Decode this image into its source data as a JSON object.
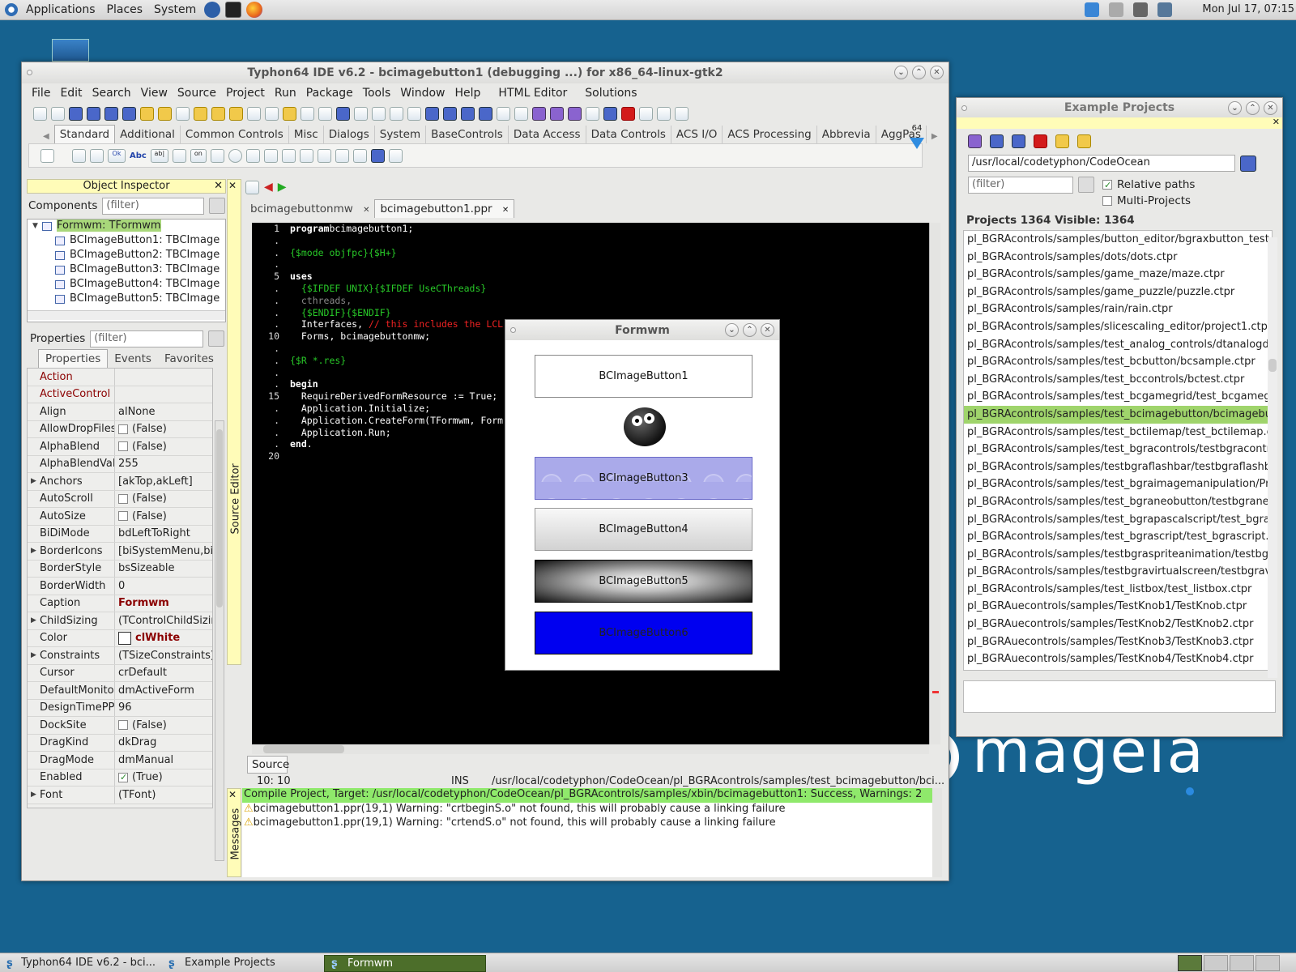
{
  "top_panel": {
    "menus": [
      "Applications",
      "Places",
      "System"
    ],
    "clock": "Mon Jul 17, 07:15"
  },
  "taskbar": {
    "items": [
      "Typhon64 IDE v6.2 - bci...",
      "Example Projects",
      "Formwm"
    ]
  },
  "desktop": {
    "logo_text": "mageia"
  },
  "ide": {
    "title": "Typhon64 IDE v6.2 - bcimagebutton1 (debugging ...) for x86_64-linux-gtk2",
    "menu": [
      "File",
      "Edit",
      "Search",
      "View",
      "Source",
      "Project",
      "Run",
      "Package",
      "Tools",
      "Window",
      "Help",
      "HTML Editor",
      "Solutions"
    ],
    "palette_tabs": [
      "Standard",
      "Additional",
      "Common Controls",
      "Misc",
      "Dialogs",
      "System",
      "BaseControls",
      "Data Access",
      "Data Controls",
      "ACS I/O",
      "ACS Processing",
      "Abbrevia",
      "AggPas"
    ],
    "palette_badge": "64",
    "palette_icons": [
      "Ok",
      "Abc",
      "ab|",
      "on"
    ],
    "object_inspector": {
      "title": "Object Inspector",
      "components_label": "Components",
      "filter_placeholder": "(filter)",
      "tree": [
        "Formwm: TFormwm",
        "BCImageButton1: TBCImage",
        "BCImageButton2: TBCImage",
        "BCImageButton3: TBCImage",
        "BCImageButton4: TBCImage",
        "BCImageButton5: TBCImage"
      ],
      "properties_label": "Properties",
      "tabs": [
        "Properties",
        "Events",
        "Favorites"
      ],
      "props": [
        {
          "name": "Action",
          "value": "",
          "ev": true
        },
        {
          "name": "ActiveControl",
          "value": "",
          "ev": true
        },
        {
          "name": "Align",
          "value": "alNone"
        },
        {
          "name": "AllowDropFiles",
          "value": "(False)",
          "chk": "off"
        },
        {
          "name": "AlphaBlend",
          "value": "(False)",
          "chk": "off"
        },
        {
          "name": "AlphaBlendVal",
          "value": "255"
        },
        {
          "name": "Anchors",
          "value": "[akTop,akLeft]",
          "exp": true
        },
        {
          "name": "AutoScroll",
          "value": "(False)",
          "chk": "off"
        },
        {
          "name": "AutoSize",
          "value": "(False)",
          "chk": "off"
        },
        {
          "name": "BiDiMode",
          "value": "bdLeftToRight"
        },
        {
          "name": "BorderIcons",
          "value": "[biSystemMenu,bi",
          "exp": true
        },
        {
          "name": "BorderStyle",
          "value": "bsSizeable"
        },
        {
          "name": "BorderWidth",
          "value": "0"
        },
        {
          "name": "Caption",
          "value": "Formwm",
          "bold": true
        },
        {
          "name": "ChildSizing",
          "value": "(TControlChildSizin",
          "exp": true
        },
        {
          "name": "Color",
          "value": "clWhite",
          "bold": true,
          "swatch": true
        },
        {
          "name": "Constraints",
          "value": "(TSizeConstraints)",
          "exp": true
        },
        {
          "name": "Cursor",
          "value": "crDefault"
        },
        {
          "name": "DefaultMonitor",
          "value": "dmActiveForm"
        },
        {
          "name": "DesignTimePP",
          "value": "96"
        },
        {
          "name": "DockSite",
          "value": "(False)",
          "chk": "off"
        },
        {
          "name": "DragKind",
          "value": "dkDrag"
        },
        {
          "name": "DragMode",
          "value": "dmManual"
        },
        {
          "name": "Enabled",
          "value": "(True)",
          "chk": "on"
        },
        {
          "name": "Font",
          "value": "(TFont)",
          "exp": true
        }
      ]
    },
    "editor": {
      "vertical_label": "Source Editor",
      "tabs": [
        "bcimagebuttonmw",
        "bcimagebutton1.ppr"
      ],
      "gutter": [
        "1",
        ".",
        ".",
        ".",
        "5",
        ".",
        ".",
        ".",
        ".",
        "10",
        ".",
        ".",
        ".",
        ".",
        "15",
        ".",
        ".",
        ".",
        ".",
        "20"
      ],
      "lines": [
        [
          [
            "kw",
            "program"
          ],
          [
            "",
            "bcimagebutton1;"
          ]
        ],
        [],
        [
          [
            "dir",
            "{$mode objfpc}{$H+}"
          ]
        ],
        [],
        [
          [
            "kw",
            "uses"
          ]
        ],
        [
          [
            "dir",
            "  {$IFDEF UNIX}{$IFDEF UseCThreads}"
          ]
        ],
        [
          [
            "gray",
            "  cthreads,"
          ]
        ],
        [
          [
            "dir",
            "  {$ENDIF}{$ENDIF}"
          ]
        ],
        [
          [
            "",
            "  Interfaces, "
          ],
          [
            "cmt",
            "// this includes the LCL"
          ]
        ],
        [
          [
            "",
            "  Forms, bcimagebuttonmw;"
          ]
        ],
        [],
        [
          [
            "dir",
            "{$R *.res}"
          ]
        ],
        [],
        [
          [
            "kw",
            "begin"
          ]
        ],
        [
          [
            "",
            "  RequireDerivedFormResource := True;"
          ]
        ],
        [
          [
            "",
            "  Application.Initialize;"
          ]
        ],
        [
          [
            "",
            "  Application.CreateForm(TFormwm, Form"
          ]
        ],
        [
          [
            "",
            "  Application.Run;"
          ]
        ],
        [
          [
            "kw",
            "end"
          ],
          [
            "",
            "."
          ]
        ],
        []
      ],
      "bottom_tab": "Source",
      "status": {
        "pos": "10: 10",
        "mode": "INS",
        "path": "/usr/local/codetyphon/CodeOcean/pl_BGRAcontrols/samples/test_bcimagebutton/bci..."
      }
    },
    "messages": {
      "vertical_label": "Messages",
      "lines": [
        "Compile Project, Target: /usr/local/codetyphon/CodeOcean/pl_BGRAcontrols/samples/xbin/bcimagebutton1: Success, Warnings: 2",
        "bcimagebutton1.ppr(19,1) Warning: \"crtbeginS.o\" not found, this will probably cause a linking failure",
        "bcimagebutton1.ppr(19,1) Warning: \"crtendS.o\" not found, this will probably cause a linking failure"
      ]
    }
  },
  "formwm": {
    "title": "Formwm",
    "buttons": [
      "BCImageButton1",
      "BCImageButton3",
      "BCImageButton4",
      "BCImageButton5",
      "BCImageButton6"
    ]
  },
  "examples": {
    "title": "Example Projects",
    "path": "/usr/local/codetyphon/CodeOcean",
    "filter_placeholder": "(filter)",
    "relative_paths": "Relative paths",
    "multi_projects": "Multi-Projects",
    "counts": "Projects 1364  Visible: 1364",
    "items": [
      "pl_BGRAcontrols/samples/button_editor/bgraxbutton_test.",
      "pl_BGRAcontrols/samples/dots/dots.ctpr",
      "pl_BGRAcontrols/samples/game_maze/maze.ctpr",
      "pl_BGRAcontrols/samples/game_puzzle/puzzle.ctpr",
      "pl_BGRAcontrols/samples/rain/rain.ctpr",
      "pl_BGRAcontrols/samples/slicescaling_editor/project1.ctpr",
      "pl_BGRAcontrols/samples/test_analog_controls/dtanalogd",
      "pl_BGRAcontrols/samples/test_bcbutton/bcsample.ctpr",
      "pl_BGRAcontrols/samples/test_bccontrols/bctest.ctpr",
      "pl_BGRAcontrols/samples/test_bcgamegrid/test_bcgameg",
      "pl_BGRAcontrols/samples/test_bcimagebutton/bcimagebu",
      "pl_BGRAcontrols/samples/test_bctilemap/test_bctilemap.c",
      "pl_BGRAcontrols/samples/test_bgracontrols/testbgracontr",
      "pl_BGRAcontrols/samples/testbgraflashbar/testbgraflashba",
      "pl_BGRAcontrols/samples/test_bgraimagemanipulation/Pr",
      "pl_BGRAcontrols/samples/test_bgraneobutton/testbgraneo",
      "pl_BGRAcontrols/samples/test_bgrapascalscript/test_bgra",
      "pl_BGRAcontrols/samples/test_bgrascript/test_bgrascript.c",
      "pl_BGRAcontrols/samples/testbgraspriteanimation/testbgr",
      "pl_BGRAcontrols/samples/testbgravirtualscreen/testbgrav",
      "pl_BGRAcontrols/samples/test_listbox/test_listbox.ctpr",
      "pl_BGRAuecontrols/samples/TestKnob1/TestKnob.ctpr",
      "pl_BGRAuecontrols/samples/TestKnob2/TestKnob2.ctpr",
      "pl_BGRAuecontrols/samples/TestKnob3/TestKnob3.ctpr",
      "pl_BGRAuecontrols/samples/TestKnob4/TestKnob4.ctpr"
    ],
    "selected_index": 10
  }
}
